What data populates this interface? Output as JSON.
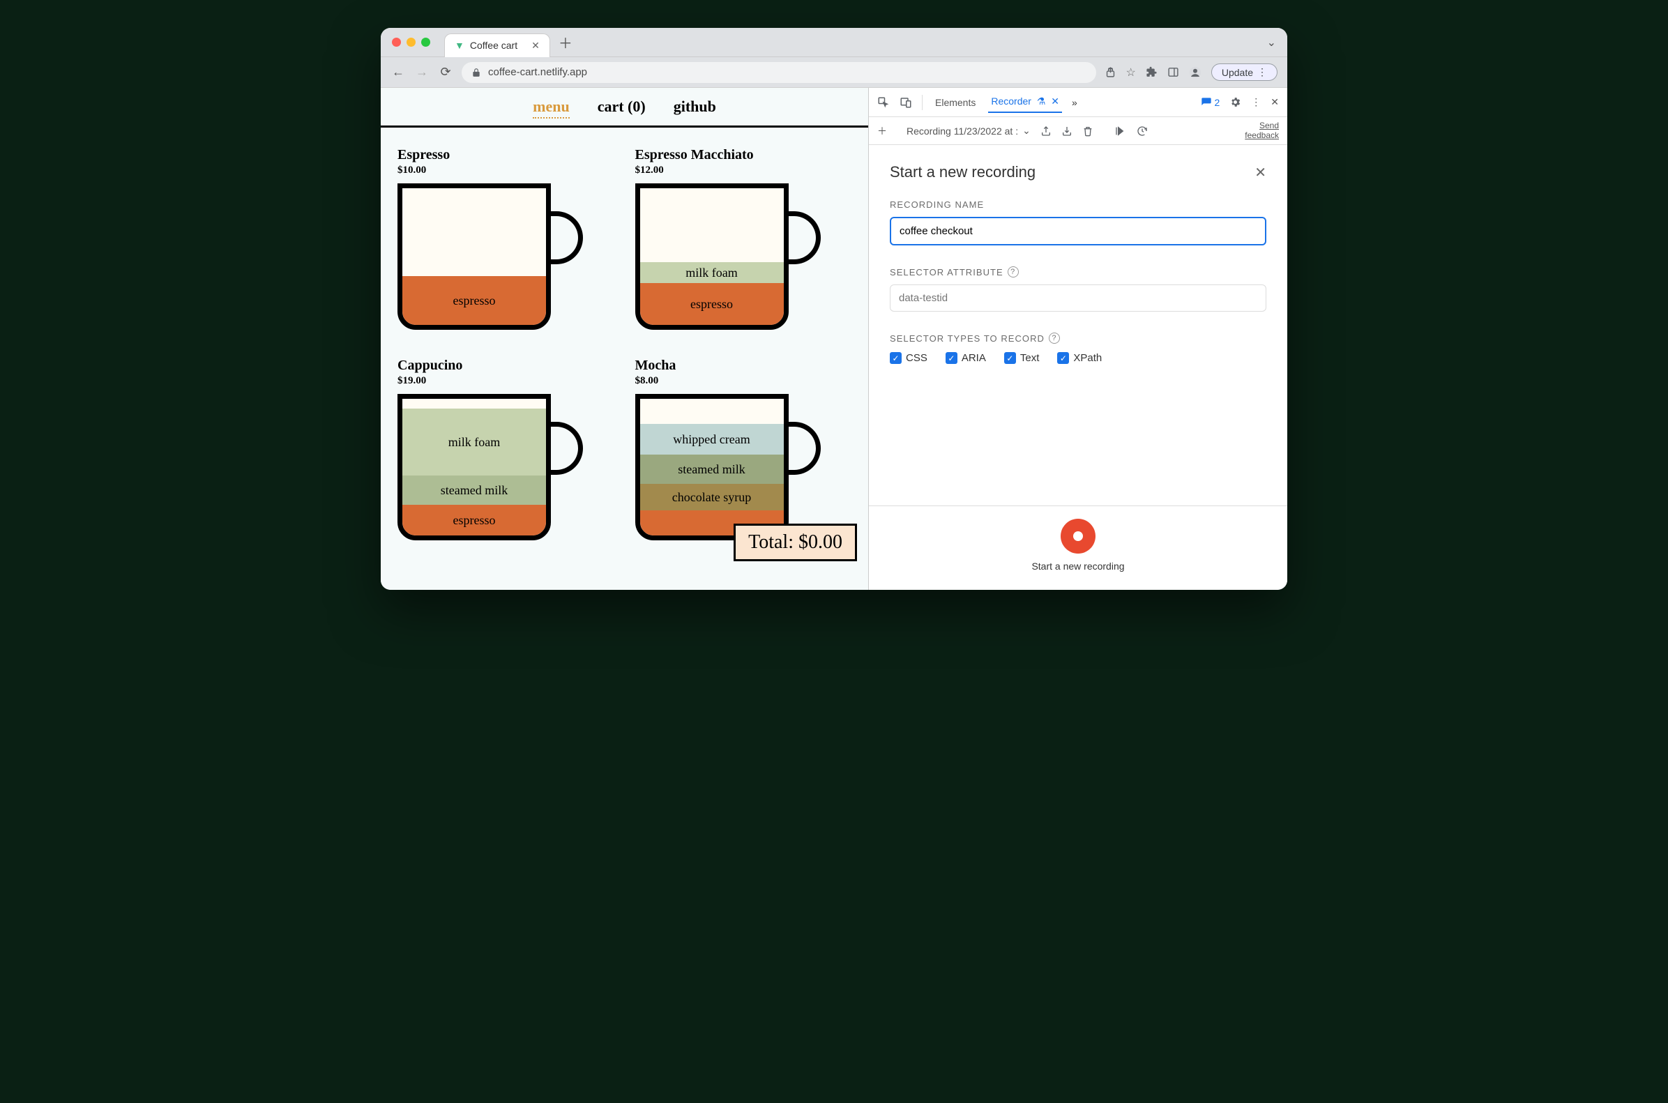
{
  "browser": {
    "tab_title": "Coffee cart",
    "url": "coffee-cart.netlify.app",
    "update_label": "Update"
  },
  "page": {
    "nav": {
      "menu": "menu",
      "cart": "cart (0)",
      "github": "github"
    },
    "products": [
      {
        "name": "Espresso",
        "price": "$10.00",
        "layers": [
          "espresso"
        ]
      },
      {
        "name": "Espresso Macchiato",
        "price": "$12.00",
        "layers": [
          "milk foam",
          "espresso"
        ]
      },
      {
        "name": "Cappucino",
        "price": "$19.00",
        "layers": [
          "milk foam",
          "steamed milk",
          "espresso"
        ]
      },
      {
        "name": "Mocha",
        "price": "$8.00",
        "layers": [
          "whipped cream",
          "steamed milk",
          "chocolate syrup"
        ]
      }
    ],
    "total_label": "Total: $0.00"
  },
  "devtools": {
    "tabs": {
      "elements": "Elements",
      "recorder": "Recorder"
    },
    "issues_count": "2",
    "recording_dropdown": "Recording 11/23/2022 at :",
    "feedback": {
      "line1": "Send",
      "line2": "feedback"
    },
    "panel": {
      "title": "Start a new recording",
      "name_label": "RECORDING NAME",
      "name_value": "coffee checkout",
      "attr_label": "SELECTOR ATTRIBUTE",
      "attr_placeholder": "data-testid",
      "types_label": "SELECTOR TYPES TO RECORD",
      "types": {
        "css": "CSS",
        "aria": "ARIA",
        "text": "Text",
        "xpath": "XPath"
      },
      "start_label": "Start a new recording"
    }
  }
}
